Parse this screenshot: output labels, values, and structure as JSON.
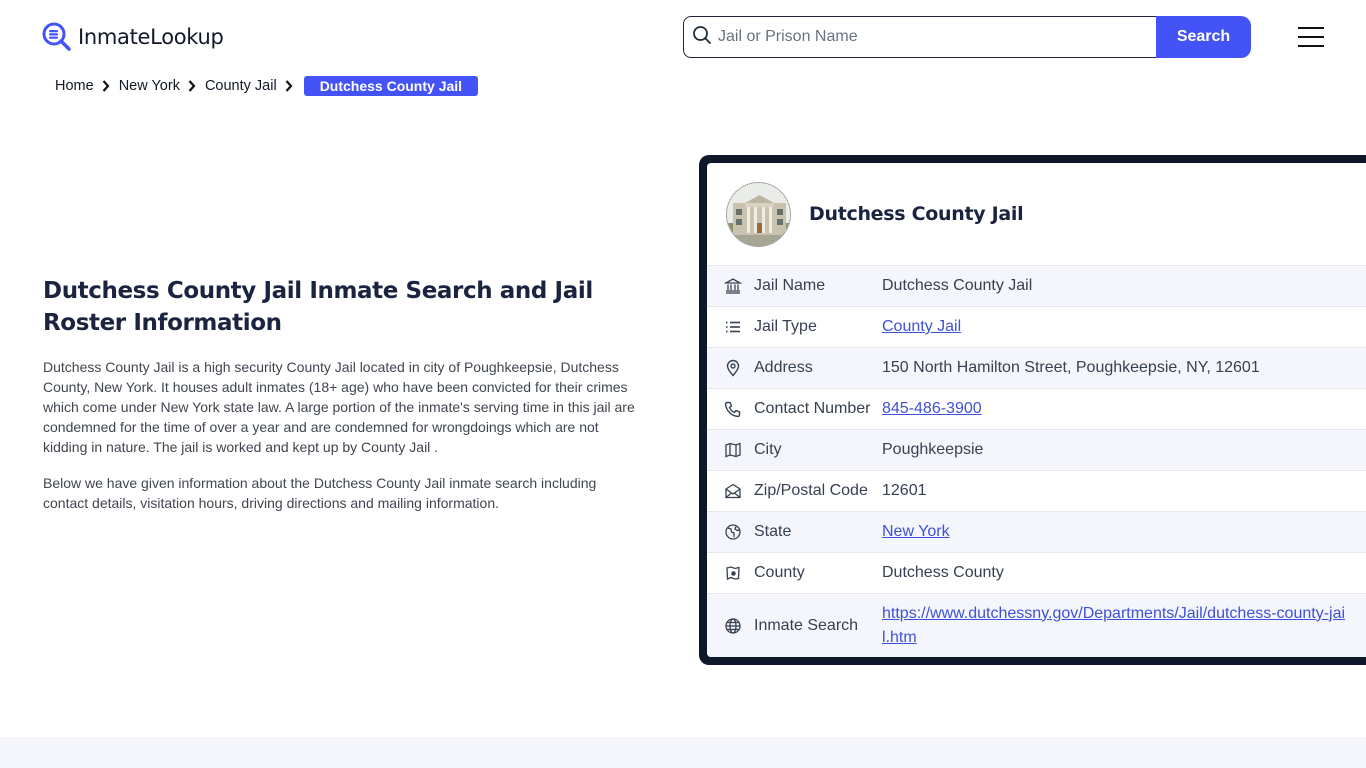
{
  "header": {
    "logo_text": "InmateLookup",
    "search_placeholder": "Jail or Prison Name",
    "search_value": "",
    "search_button": "Search",
    "brand_color": "#4353f5"
  },
  "breadcrumb": {
    "items": [
      "Home",
      "New York",
      "County Jail"
    ],
    "current": "Dutchess County Jail"
  },
  "intro": {
    "title": "Dutchess County Jail Inmate Search and Jail Roster Information",
    "paragraphs": [
      "Dutchess County Jail is a high security County Jail located in city of Poughkeepsie, Dutchess County, New York. It houses adult inmates (18+ age) who have been convicted for their crimes which come under New York state law. A large portion of the inmate's serving time in this jail are condemned for the time of over a year and are condemned for wrongdoings which are not kidding in nature. The jail is worked and kept up by County Jail .",
      "Below we have given information about the Dutchess County Jail inmate search including contact details, visitation hours, driving directions and mailing information."
    ]
  },
  "card": {
    "title": "Dutchess County Jail",
    "avatar_alt": "Dutchess County Jail building photo",
    "rows": [
      {
        "icon": "bank-icon",
        "label": "Jail Name",
        "value": "Dutchess County Jail",
        "link": false
      },
      {
        "icon": "list-icon",
        "label": "Jail Type",
        "value": "County Jail",
        "link": true
      },
      {
        "icon": "map-pin-icon",
        "label": "Address",
        "value": "150 North Hamilton Street, Poughkeepsie, NY, 12601",
        "link": false
      },
      {
        "icon": "phone-icon",
        "label": "Contact Number",
        "value": "845-486-3900",
        "link": true
      },
      {
        "icon": "map-icon",
        "label": "City",
        "value": "Poughkeepsie",
        "link": false
      },
      {
        "icon": "mail-open-icon",
        "label": "Zip/Postal Code",
        "value": "12601",
        "link": false
      },
      {
        "icon": "globe-icon",
        "label": "State",
        "value": "New York",
        "link": true
      },
      {
        "icon": "county-map-icon",
        "label": "County",
        "value": "Dutchess County",
        "link": false
      },
      {
        "icon": "world-icon",
        "label": "Inmate Search",
        "value": "https://www.dutchessny.gov/Departments/Jail/dutchess-county-jail.htm",
        "link": true
      }
    ]
  }
}
